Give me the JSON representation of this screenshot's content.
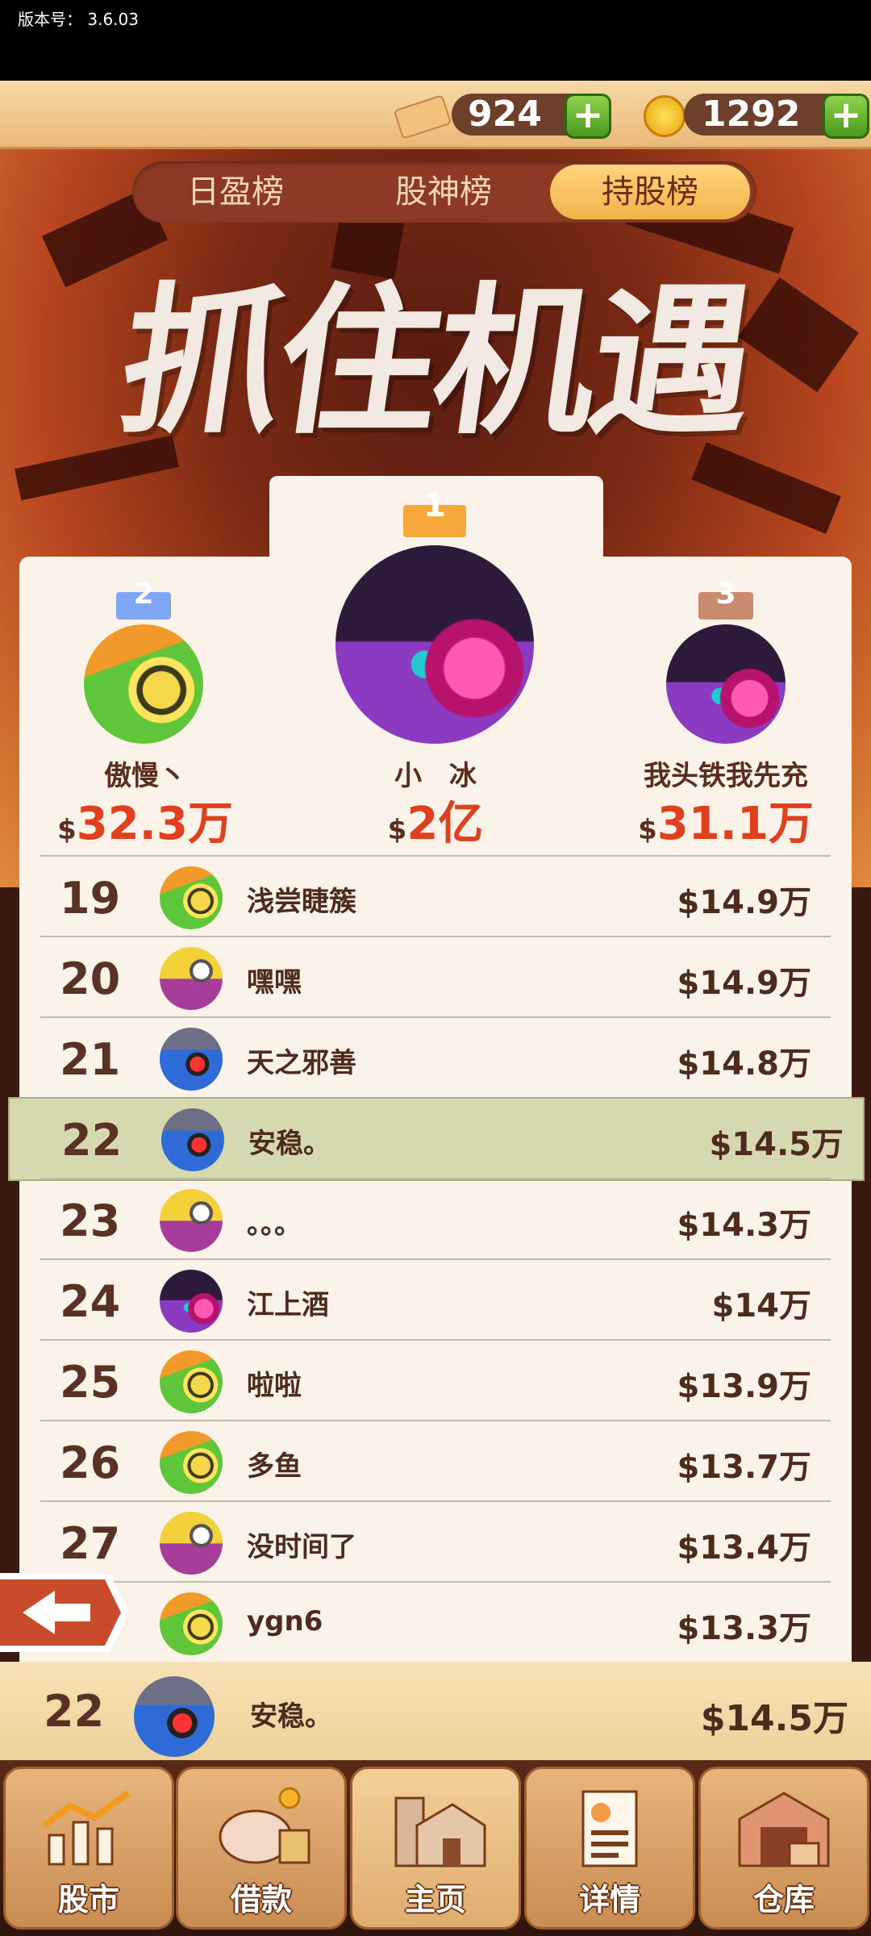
{
  "version": {
    "text": "版本号： 3.6.03"
  },
  "currency": {
    "cash": "924",
    "coins": "1292"
  },
  "tabs": [
    {
      "label": "日盈榜",
      "active": false
    },
    {
      "label": "股神榜",
      "active": false
    },
    {
      "label": "持股榜",
      "active": true
    }
  ],
  "title": "抓住机遇",
  "podium": [
    {
      "rank": "2",
      "name": "傲慢丶",
      "dollar": "$",
      "amount": "32.3万"
    },
    {
      "rank": "1",
      "name": "小　冰",
      "dollar": "$",
      "amount": "2亿"
    },
    {
      "rank": "3",
      "name": "我头铁我先充",
      "dollar": "$",
      "amount": "31.1万"
    }
  ],
  "rows": [
    {
      "rank": "19",
      "name": "浅尝睫簇",
      "value": "$14.9万",
      "avatar": "green-icon"
    },
    {
      "rank": "20",
      "name": "嘿嘿",
      "value": "$14.9万",
      "avatar": "fish-icon"
    },
    {
      "rank": "21",
      "name": "天之邪善",
      "value": "$14.8万",
      "avatar": "robot-icon"
    },
    {
      "rank": "22",
      "name": "安稳。",
      "value": "$14.5万",
      "avatar": "robot-icon",
      "highlight": true
    },
    {
      "rank": "23",
      "name": "。。。",
      "value": "$14.3万",
      "avatar": "fish-icon"
    },
    {
      "rank": "24",
      "name": "江上酒",
      "value": "$14万",
      "avatar": "purple-icon"
    },
    {
      "rank": "25",
      "name": "啦啦",
      "value": "$13.9万",
      "avatar": "green-icon"
    },
    {
      "rank": "26",
      "name": "多鱼",
      "value": "$13.7万",
      "avatar": "green-icon"
    },
    {
      "rank": "27",
      "name": "没时间了",
      "value": "$13.4万",
      "avatar": "fish-icon"
    },
    {
      "rank": "",
      "name": "ygn6",
      "value": "$13.3万",
      "avatar": "green-icon"
    }
  ],
  "my_rank": {
    "rank": "22",
    "name": "安稳。",
    "value": "$14.5万"
  },
  "nav": [
    {
      "label": "股市",
      "icon": "stock-chart-icon"
    },
    {
      "label": "借款",
      "icon": "piggy-bank-icon"
    },
    {
      "label": "主页",
      "icon": "home-icon"
    },
    {
      "label": "详情",
      "icon": "document-icon"
    },
    {
      "label": "仓库",
      "icon": "warehouse-icon"
    }
  ]
}
